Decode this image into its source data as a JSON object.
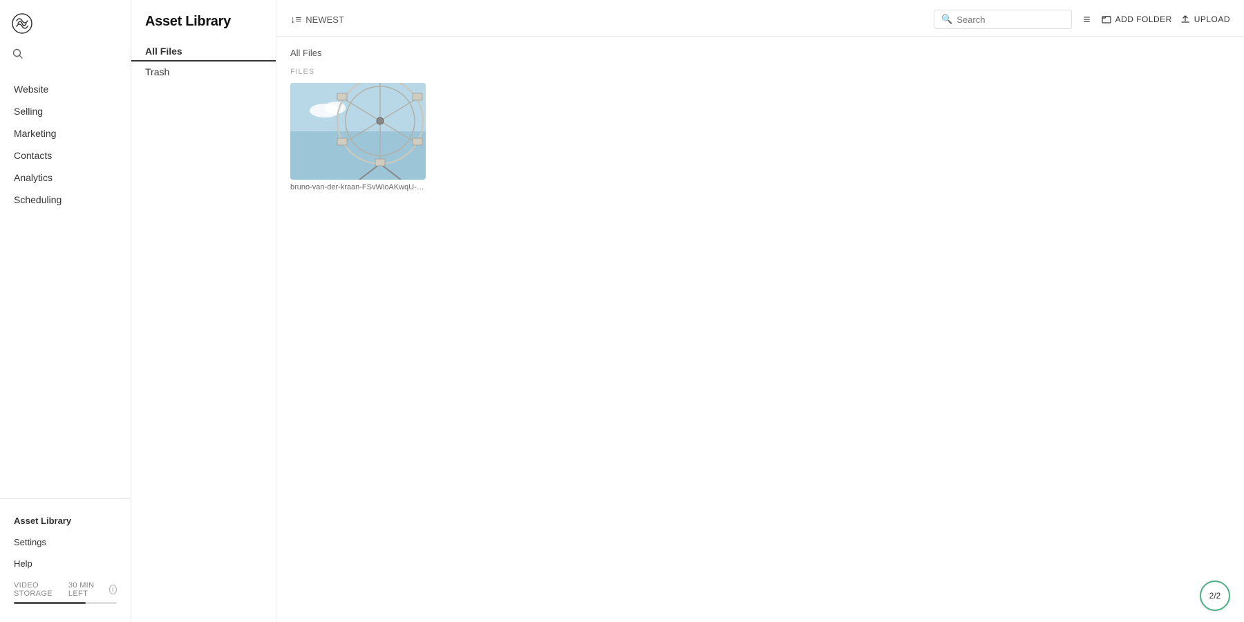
{
  "sidebar": {
    "logo_alt": "Squarespace logo",
    "nav_items": [
      {
        "id": "website",
        "label": "Website"
      },
      {
        "id": "selling",
        "label": "Selling"
      },
      {
        "id": "marketing",
        "label": "Marketing"
      },
      {
        "id": "contacts",
        "label": "Contacts"
      },
      {
        "id": "analytics",
        "label": "Analytics"
      },
      {
        "id": "scheduling",
        "label": "Scheduling"
      }
    ],
    "bottom_items": [
      {
        "id": "asset-library",
        "label": "Asset Library",
        "active": true
      },
      {
        "id": "settings",
        "label": "Settings"
      },
      {
        "id": "help",
        "label": "Help"
      }
    ],
    "storage": {
      "label": "VIDEO STORAGE",
      "time_left": "30 MIN LEFT",
      "fill_percent": 70
    }
  },
  "folder_panel": {
    "title": "Asset Library",
    "nav_items": [
      {
        "id": "all-files",
        "label": "All Files",
        "active": true
      },
      {
        "id": "trash",
        "label": "Trash"
      }
    ]
  },
  "toolbar": {
    "sort_label": "NEWEST",
    "add_folder_label": "ADD FOLDER",
    "upload_label": "UPLOAD",
    "search_placeholder": "Search",
    "view_icon": "≡"
  },
  "main": {
    "breadcrumb": "All Files",
    "section_label": "FILES",
    "files": [
      {
        "id": "file-1",
        "name": "bruno-van-der-kraan-FSvWioAKwqU-unsplas...",
        "thumb_type": "ferris-wheel"
      }
    ]
  },
  "badge": {
    "label": "2/2"
  }
}
